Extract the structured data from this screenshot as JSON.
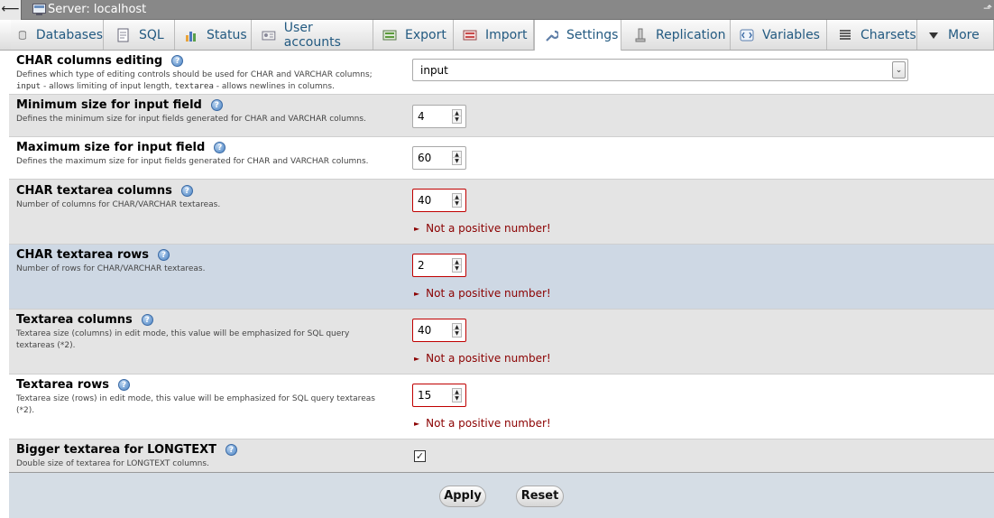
{
  "titlebar": {
    "back_glyph": "⟵",
    "server_label": "Server: localhost",
    "corner_glyph": "⬏"
  },
  "tabs": [
    {
      "label": "Databases",
      "icon": "database-icon"
    },
    {
      "label": "SQL",
      "icon": "sql-icon"
    },
    {
      "label": "Status",
      "icon": "status-chart-icon"
    },
    {
      "label": "User accounts",
      "icon": "user-accounts-icon"
    },
    {
      "label": "Export",
      "icon": "export-icon"
    },
    {
      "label": "Import",
      "icon": "import-icon"
    },
    {
      "label": "Settings",
      "icon": "wrench-icon",
      "active": true
    },
    {
      "label": "Replication",
      "icon": "replication-icon"
    },
    {
      "label": "Variables",
      "icon": "variables-icon"
    },
    {
      "label": "Charsets",
      "icon": "charsets-icon"
    },
    {
      "label": "More",
      "icon": "caret-down-icon"
    }
  ],
  "settings": {
    "char_editing": {
      "title": "CHAR columns editing",
      "desc_line1": "Defines which type of editing controls should be used for CHAR and VARCHAR columns;",
      "desc_code1": "input",
      "desc_mid": " - allows limiting of input length, ",
      "desc_code2": "textarea",
      "desc_end": " - allows newlines in columns.",
      "value": "input"
    },
    "min_size": {
      "title": "Minimum size for input field",
      "desc": "Defines the minimum size for input fields generated for CHAR and VARCHAR columns.",
      "value": "4"
    },
    "max_size": {
      "title": "Maximum size for input field",
      "desc": "Defines the maximum size for input fields generated for CHAR and VARCHAR columns.",
      "value": "60"
    },
    "char_ta_cols": {
      "title": "CHAR textarea columns",
      "desc": "Number of columns for CHAR/VARCHAR textareas.",
      "value": "40",
      "error": "Not a positive number!"
    },
    "char_ta_rows": {
      "title": "CHAR textarea rows",
      "desc": "Number of rows for CHAR/VARCHAR textareas.",
      "value": "2",
      "error": "Not a positive number!"
    },
    "ta_cols": {
      "title": "Textarea columns",
      "desc_line1": "Textarea size (columns) in edit mode, this value will be emphasized for SQL query",
      "desc_line2": "textareas (*2).",
      "value": "40",
      "error": "Not a positive number!"
    },
    "ta_rows": {
      "title": "Textarea rows",
      "desc_line1": "Textarea size (rows) in edit mode, this value will be emphasized for SQL query textareas",
      "desc_line2": "(*2).",
      "value": "15",
      "error": "Not a positive number!"
    },
    "longtext": {
      "title": "Bigger textarea for LONGTEXT",
      "desc": "Double size of textarea for LONGTEXT columns.",
      "checked": true
    }
  },
  "help_glyph": "?",
  "spin_up": "▲",
  "spin_down": "▼",
  "select_caret": "⌄",
  "error_bullet": "►",
  "check_glyph": "✓",
  "footer": {
    "apply_label": "Apply",
    "reset_label": "Reset"
  },
  "colors": {
    "tab_text": "#235a81",
    "error_text": "#8b0000",
    "error_border": "#c00000",
    "hover_row": "#ced8e4"
  }
}
